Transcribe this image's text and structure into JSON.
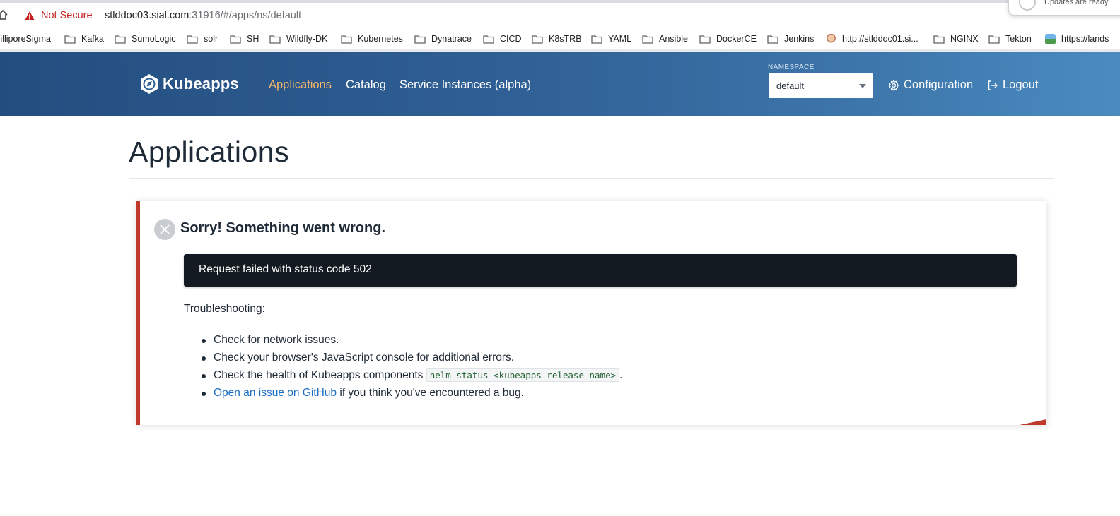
{
  "browser": {
    "not_secure": "Not Secure",
    "url_host": "stlddoc03.sial.com",
    "url_rest": ":31916/#/apps/ns/default",
    "notification_text": "Updates are ready"
  },
  "bookmarks": [
    {
      "label": "MilliporeSigma",
      "icon": "none"
    },
    {
      "label": "Kafka",
      "icon": "folder-icon"
    },
    {
      "label": "SumoLogic",
      "icon": "folder-icon"
    },
    {
      "label": "solr",
      "icon": "folder-icon"
    },
    {
      "label": "SH",
      "icon": "folder-icon"
    },
    {
      "label": "Wildfly-DK",
      "icon": "folder-icon"
    },
    {
      "label": "Kubernetes",
      "icon": "folder-icon"
    },
    {
      "label": "Dynatrace",
      "icon": "folder-icon"
    },
    {
      "label": "CICD",
      "icon": "folder-icon"
    },
    {
      "label": "K8sTRB",
      "icon": "folder-icon"
    },
    {
      "label": "YAML",
      "icon": "folder-icon"
    },
    {
      "label": "Ansible",
      "icon": "folder-icon"
    },
    {
      "label": "DockerCE",
      "icon": "folder-icon"
    },
    {
      "label": "Jenkins",
      "icon": "folder-icon"
    },
    {
      "label": "http://stlddoc01.si...",
      "icon": "jenkins-favicon"
    },
    {
      "label": "NGINX",
      "icon": "folder-icon"
    },
    {
      "label": "Tekton",
      "icon": "folder-icon"
    },
    {
      "label": "https://lands",
      "icon": "image-favicon"
    }
  ],
  "header": {
    "brand": "Kubeapps",
    "nav": {
      "applications": "Applications",
      "catalog": "Catalog",
      "service_instances": "Service Instances (alpha)"
    },
    "namespace_label": "NAMESPACE",
    "namespace_value": "default",
    "configuration": "Configuration",
    "logout": "Logout"
  },
  "main": {
    "title": "Applications",
    "error": {
      "title": "Sorry! Something went wrong.",
      "message": "Request failed with status code 502",
      "troubleshooting_label": "Troubleshooting:",
      "items": {
        "network": "Check for network issues.",
        "console": "Check your browser's JavaScript console for additional errors.",
        "health_prefix": "Check the health of Kubeapps components ",
        "health_code": "helm status <kubeapps_release_name>",
        "health_suffix": ".",
        "github_link": "Open an issue on GitHub",
        "github_suffix": " if you think you've encountered a bug."
      }
    }
  },
  "colors": {
    "accent_active_nav": "#f4b56a",
    "error_border": "#c0392b",
    "link": "#1a6fc4",
    "header_start": "#244d7f",
    "header_end": "#4a8bc0"
  }
}
